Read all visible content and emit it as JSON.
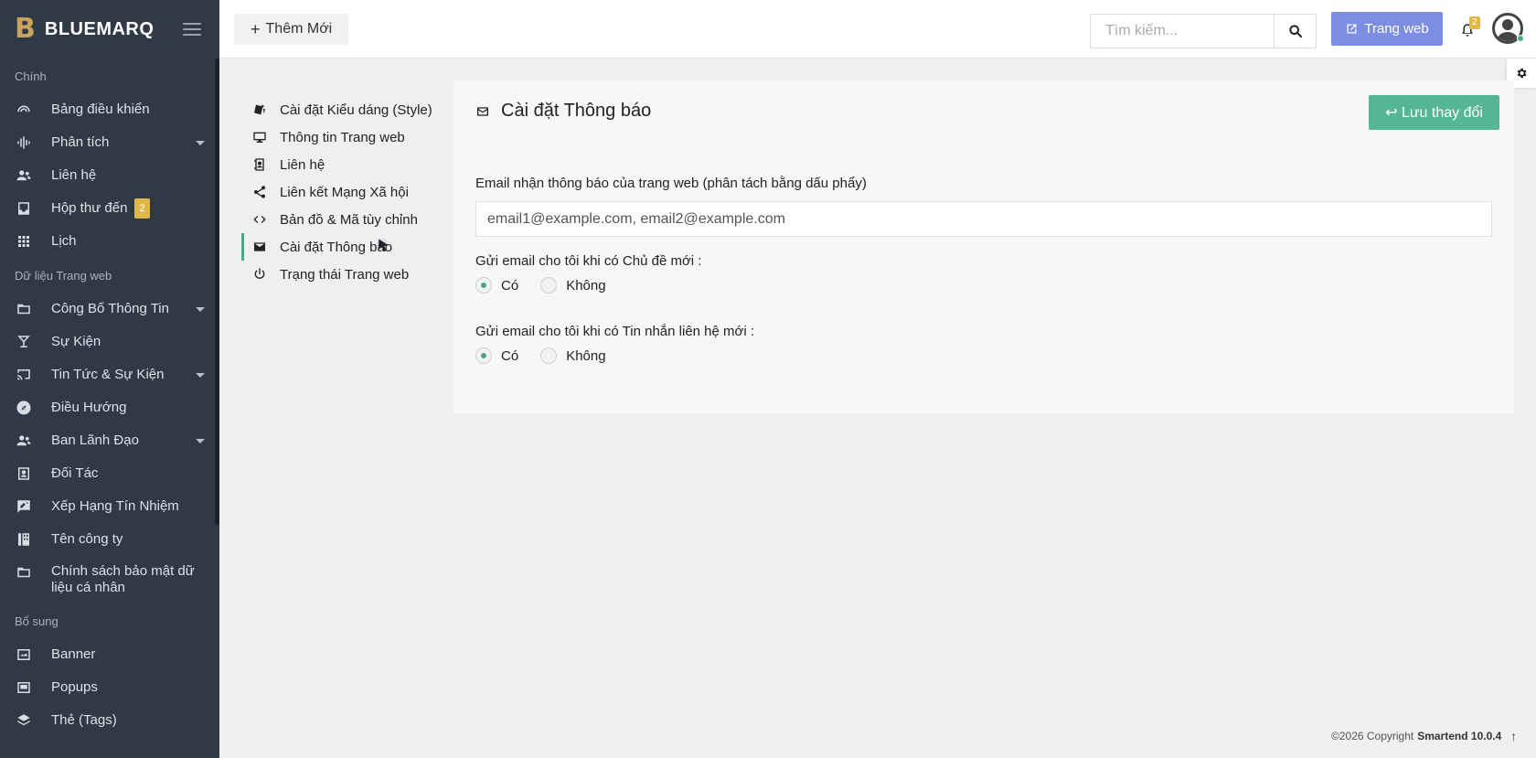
{
  "brand": {
    "logo": "B",
    "name": "BLUEMARQ"
  },
  "sidebar": {
    "sections": [
      {
        "title": "Chính",
        "items": [
          {
            "label": "Bảng điều khiển",
            "icon": "dashboard-icon",
            "caret": false
          },
          {
            "label": "Phân tích",
            "icon": "analytics-icon",
            "caret": true
          },
          {
            "label": "Liên hệ",
            "icon": "contacts-icon",
            "caret": false
          },
          {
            "label": "Hộp thư đến",
            "icon": "inbox-icon",
            "caret": false,
            "badge": "2"
          },
          {
            "label": "Lịch",
            "icon": "calendar-icon",
            "caret": false
          }
        ]
      },
      {
        "title": "Dữ liệu Trang web",
        "items": [
          {
            "label": "Công Bố Thông Tin",
            "icon": "folder-icon",
            "caret": true
          },
          {
            "label": "Sự Kiện",
            "icon": "cocktail-icon",
            "caret": false
          },
          {
            "label": "Tin Tức & Sự Kiện",
            "icon": "cast-icon",
            "caret": true
          },
          {
            "label": "Điều Hướng",
            "icon": "compass-icon",
            "caret": false
          },
          {
            "label": "Ban Lãnh Đạo",
            "icon": "people-icon",
            "caret": true
          },
          {
            "label": "Đối Tác",
            "icon": "contact-card-icon",
            "caret": false
          },
          {
            "label": "Xếp Hạng Tín Nhiệm",
            "icon": "rating-icon",
            "caret": false
          },
          {
            "label": "Tên công ty",
            "icon": "company-icon",
            "caret": false
          },
          {
            "label": "Chính sách bảo mật dữ liệu cá nhân",
            "icon": "folder-icon",
            "caret": false
          }
        ]
      },
      {
        "title": "Bổ sung",
        "items": [
          {
            "label": "Banner",
            "icon": "banner-icon",
            "caret": false
          },
          {
            "label": "Popups",
            "icon": "popup-icon",
            "caret": false
          },
          {
            "label": "Thẻ (Tags)",
            "icon": "tag-icon",
            "caret": false
          }
        ]
      }
    ]
  },
  "topbar": {
    "add_label": "Thêm Mới",
    "search_placeholder": "Tìm kiếm...",
    "web_label": "Trang web",
    "notif_count": "2"
  },
  "subnav": {
    "items": [
      {
        "label": "Cài đặt Kiểu dáng (Style)",
        "icon": "paint-icon",
        "active": false
      },
      {
        "label": "Thông tin Trang web",
        "icon": "monitor-icon",
        "active": false
      },
      {
        "label": "Liên hệ",
        "icon": "contact-book-icon",
        "active": false
      },
      {
        "label": "Liên kết Mạng Xã hội",
        "icon": "share-icon",
        "active": false
      },
      {
        "label": "Bản đồ & Mã tùy chỉnh",
        "icon": "code-icon",
        "active": false
      },
      {
        "label": "Cài đặt Thông báo",
        "icon": "mail-icon",
        "active": true
      },
      {
        "label": "Trạng thái Trang web",
        "icon": "power-icon",
        "active": false
      }
    ]
  },
  "card": {
    "title": "Cài đặt Thông báo",
    "save_label": "↩ Lưu thay đổi",
    "email_label": "Email nhận thông báo của trang web (phân tách bằng dấu phẩy)",
    "email_value": "email1@example.com, email2@example.com",
    "topic_label": "Gửi email cho tôi khi có Chủ đề mới :",
    "message_label": "Gửi email cho tôi khi có Tin nhắn liên hệ mới :",
    "yes": "Có",
    "no": "Không",
    "topic_selected": "yes",
    "message_selected": "yes"
  },
  "footer": {
    "copyright": "©2026 Copyright",
    "product": "Smartend 10.0.4"
  }
}
